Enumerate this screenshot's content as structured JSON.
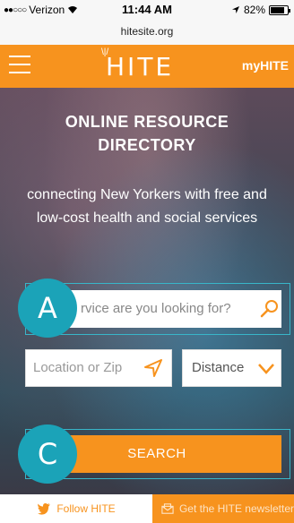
{
  "status_bar": {
    "carrier": "Verizon",
    "signal_dots": "●●○○○",
    "time": "11:44 AM",
    "url": "hitesite.org",
    "battery": "82%",
    "battery_level": 0.82
  },
  "header": {
    "logo": "HITE",
    "logo_rays": "\\|/",
    "my_link": "myHITE"
  },
  "hero": {
    "title_line1": "ONLINE RESOURCE",
    "title_line2": "DIRECTORY",
    "subtitle": "connecting New Yorkers with free and low-cost health and social services"
  },
  "search": {
    "value": "rvice are you looking for?"
  },
  "location": {
    "placeholder": "Location or Zip"
  },
  "distance": {
    "label": "Distance"
  },
  "search_button": {
    "label": "SEARCH"
  },
  "badges": {
    "a": "A",
    "c": "C"
  },
  "footer": {
    "follow": "Follow HITE",
    "newsletter": "Get the HITE newsletter"
  },
  "colors": {
    "brand_orange": "#f7931e",
    "badge_teal": "#1ba3b8",
    "outline_blue": "#38b6c9"
  }
}
